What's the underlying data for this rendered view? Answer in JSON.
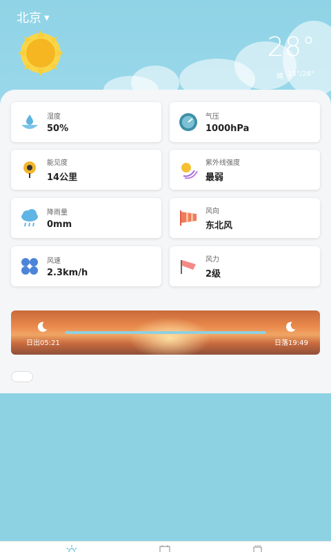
{
  "header": {
    "city": "北京",
    "temperature": "28°",
    "condition": "晴",
    "range": "15°/28°"
  },
  "cards": [
    {
      "name": "humidity",
      "label": "湿度",
      "value": "50%"
    },
    {
      "name": "pressure",
      "label": "气压",
      "value": "1000hPa"
    },
    {
      "name": "visibility",
      "label": "能见度",
      "value": "14公里"
    },
    {
      "name": "uv",
      "label": "紫外线强度",
      "value": "最弱"
    },
    {
      "name": "rainfall",
      "label": "降雨量",
      "value": "0mm"
    },
    {
      "name": "wind-direction",
      "label": "风向",
      "value": "东北风"
    },
    {
      "name": "wind-speed",
      "label": "风速",
      "value": "2.3km/h"
    },
    {
      "name": "wind-force",
      "label": "风力",
      "value": "2级"
    }
  ],
  "sun": {
    "sunrise": "日出05:21",
    "sunset": "日落19:49"
  },
  "colors": {
    "accent": "#8dd2e3",
    "sun": "#f7c33a"
  },
  "icons": {
    "location_caret": "caret-down-icon",
    "weather": "sun-icon",
    "nav": [
      "weather-icon",
      "calendar-icon",
      "tea-icon"
    ]
  }
}
